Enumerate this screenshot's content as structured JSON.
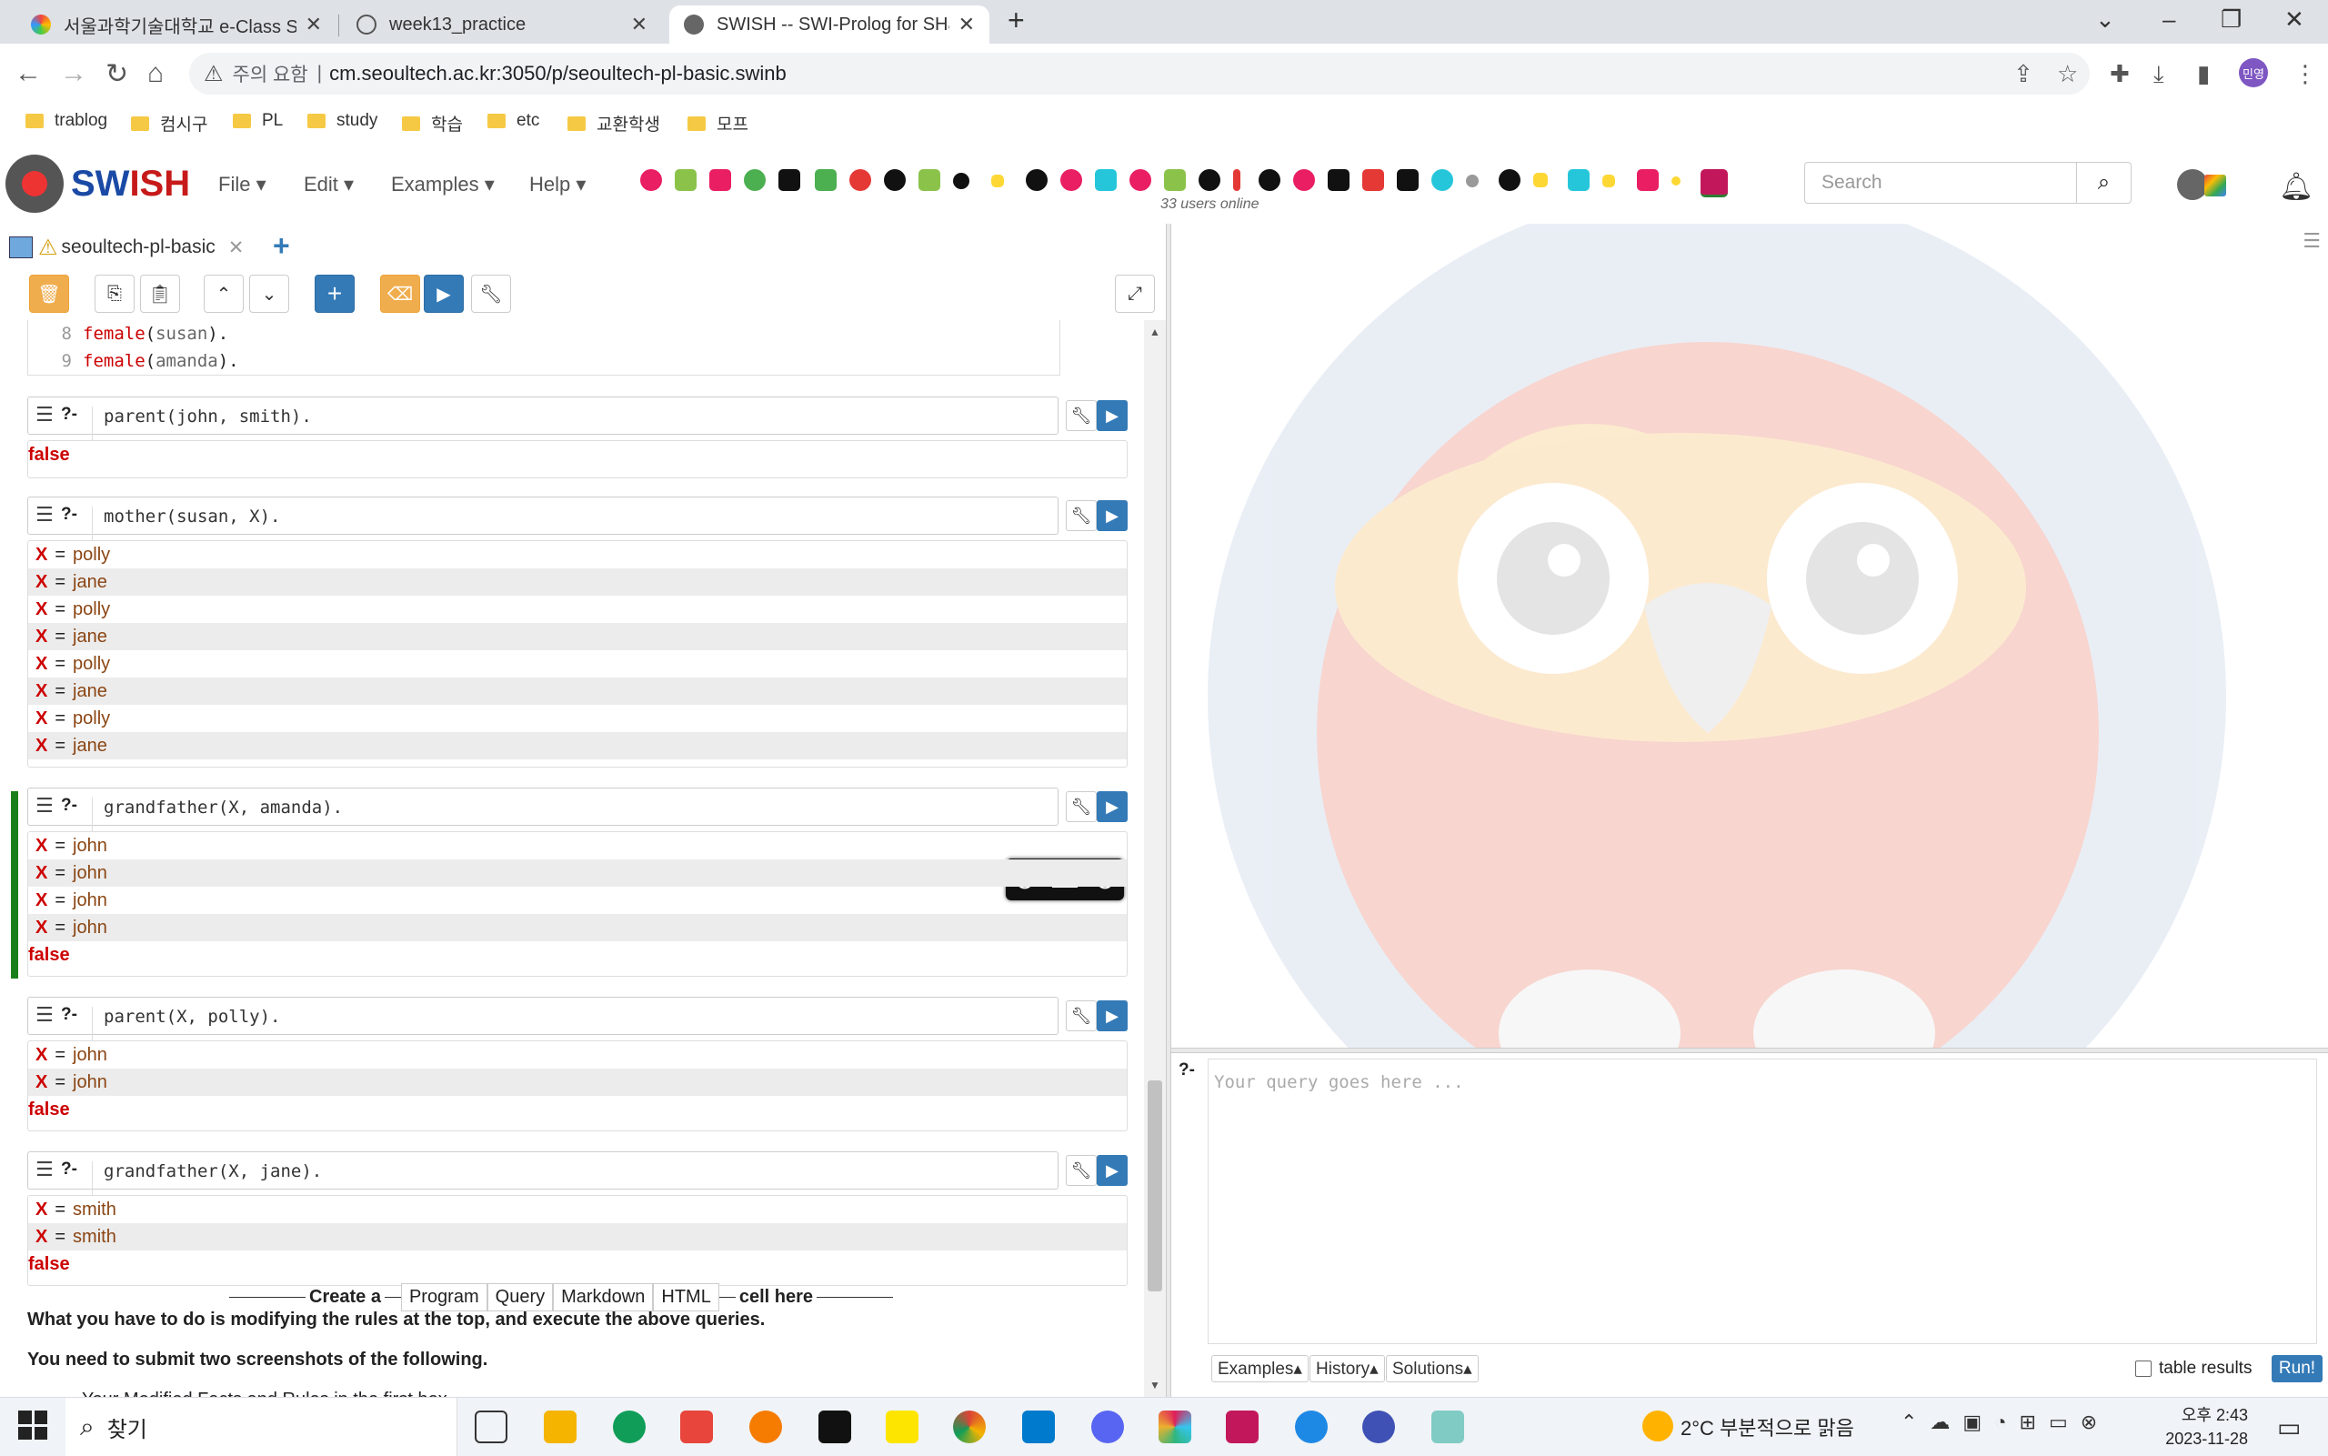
{
  "browser": {
    "tabs": [
      {
        "title": "서울과학기술대학교 e-Class Sys",
        "active": false
      },
      {
        "title": "week13_practice",
        "active": false
      },
      {
        "title": "SWISH -- SWI-Prolog for SHari",
        "active": true
      }
    ],
    "new_tab": "+",
    "security_label": "주의 요함",
    "url": "cm.seoultech.ac.kr:3050/p/seoultech-pl-basic.swinb",
    "profile_initials": "민영",
    "bookmarks": [
      "trablog",
      "컴시구",
      "PL",
      "study",
      "학습",
      "etc",
      "교환학생",
      "모프"
    ]
  },
  "swish": {
    "brand_sw": "SW",
    "brand_ish": "ISH",
    "menus": [
      "File",
      "Edit",
      "Examples",
      "Help"
    ],
    "users_online": "33 users online",
    "search_placeholder": "Search"
  },
  "notebook": {
    "tab_label": "seoultech-pl-basic",
    "program_lines": [
      {
        "num": "8",
        "pred": "female",
        "arg": "susan"
      },
      {
        "num": "9",
        "pred": "female",
        "arg": "amanda"
      }
    ],
    "queries": [
      {
        "prompt": "?-",
        "pred": "parent",
        "args": "(john, smith).",
        "answers": [],
        "tail": "false"
      },
      {
        "prompt": "?-",
        "pred": "mother",
        "args": "(susan, X).",
        "answers": [
          "polly",
          "jane",
          "polly",
          "jane",
          "polly",
          "jane",
          "polly",
          "jane"
        ],
        "tail": ""
      },
      {
        "prompt": "?-",
        "pred": "grandfather",
        "args": "(X, amanda).",
        "answers": [
          "john",
          "john",
          "john",
          "john"
        ],
        "tail": "false"
      },
      {
        "prompt": "?-",
        "pred": "parent",
        "args": "(X, polly).",
        "answers": [
          "john",
          "john"
        ],
        "tail": "false"
      },
      {
        "prompt": "?-",
        "pred": "grandfather",
        "args": "(X, jane).",
        "answers": [
          "smith",
          "smith"
        ],
        "tail": "false"
      }
    ],
    "answer_var": "X",
    "create_cell": {
      "prefix": "Create a",
      "options": [
        "Program",
        "Query",
        "Markdown",
        "HTML"
      ],
      "suffix": "cell here"
    },
    "paragraph1": "What you have to do is modifying the rules at the top, and execute the above queries.",
    "paragraph2": "You need to submit two screenshots of the following.",
    "paragraph3": "Your Modified Facts and Rules in the first box"
  },
  "query_editor": {
    "prompt": "?-",
    "placeholder": "Your query goes here ...",
    "buttons": [
      "Examples▴",
      "History▴",
      "Solutions▴"
    ],
    "table_results": "table results",
    "run": "Run!"
  },
  "taskbar": {
    "search": "찾기",
    "weather": "2°C  부분적으로 맑음",
    "time": "오후 2:43",
    "date": "2023-11-28"
  },
  "colors": {
    "accent_blue": "#337ab7",
    "accent_orange": "#f0ad4e",
    "error_red": "#cc0000",
    "running_green": "#1a7f1a"
  }
}
